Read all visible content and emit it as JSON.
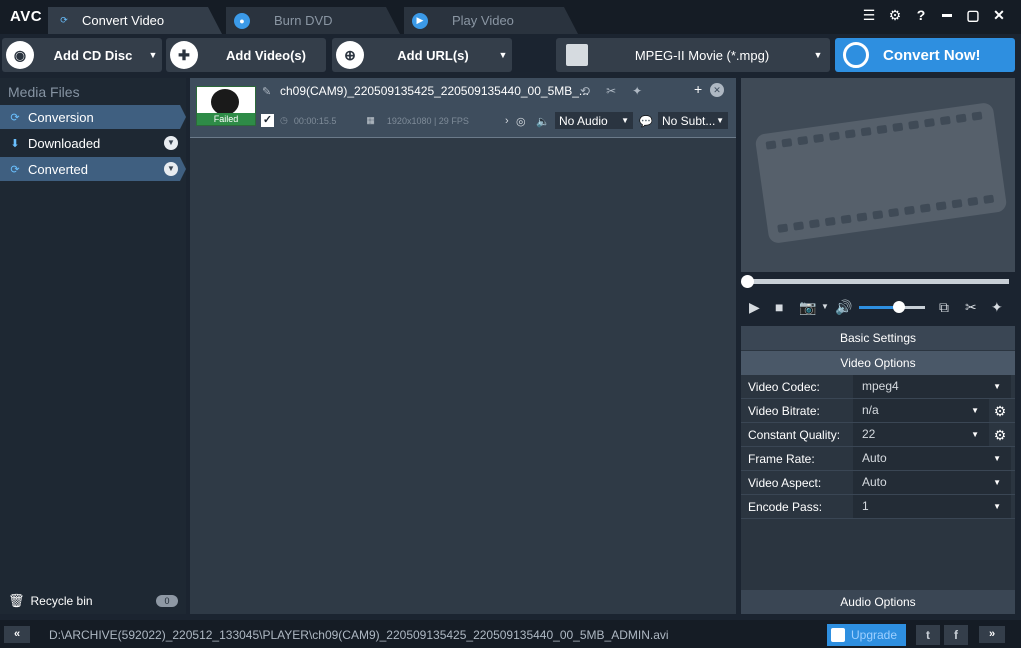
{
  "app": {
    "logo": "AVC"
  },
  "tabs": [
    {
      "label": "Convert Video",
      "icon": "convert-icon"
    },
    {
      "label": "Burn DVD",
      "icon": "disc-icon"
    },
    {
      "label": "Play Video",
      "icon": "play-icon"
    }
  ],
  "system": {
    "menu": "☰",
    "settings": "⚙",
    "help": "?",
    "minimize": "▬",
    "maximize": "▢",
    "close": "✕"
  },
  "toolbar": {
    "add_cd": "Add CD Disc",
    "add_video": "Add Video(s)",
    "add_url": "Add URL(s)",
    "format": "MPEG-II Movie (*.mpg)",
    "convert_now": "Convert Now!"
  },
  "sidebar": {
    "header": "Media Files",
    "items": [
      {
        "label": "Conversion"
      },
      {
        "label": "Downloaded"
      },
      {
        "label": "Converted"
      }
    ],
    "recycle": {
      "label": "Recycle bin",
      "count": "0"
    }
  },
  "file_item": {
    "status": "Failed",
    "name": "ch09(CAM9)_220509135425_220509135440_00_5MB_...",
    "duration": "00:00:15.5",
    "resolution_fps": "1920x1080 | 29 FPS",
    "audio": "No Audio",
    "subtitle": "No Subt..."
  },
  "settings": {
    "basic": "Basic Settings",
    "video_options": "Video Options",
    "rows": [
      {
        "label": "Video Codec:",
        "value": "mpeg4"
      },
      {
        "label": "Video Bitrate:",
        "value": "n/a"
      },
      {
        "label": "Constant Quality:",
        "value": "22"
      },
      {
        "label": "Frame Rate:",
        "value": "Auto"
      },
      {
        "label": "Video Aspect:",
        "value": "Auto"
      },
      {
        "label": "Encode Pass:",
        "value": "1"
      }
    ],
    "audio_options": "Audio Options"
  },
  "player": {
    "seek_position": 0,
    "volume": 0.6
  },
  "statusbar": {
    "path": "D:\\ARCHIVE(592022)_220512_133045\\PLAYER\\ch09(CAM9)_220509135425_220509135440_00_5MB_ADMIN.avi",
    "upgrade": "Upgrade",
    "twitter": "t",
    "facebook": "f"
  },
  "colors": {
    "accent": "#2e8fe0",
    "failed": "#2e8b47",
    "selected": "#3f5f80"
  }
}
